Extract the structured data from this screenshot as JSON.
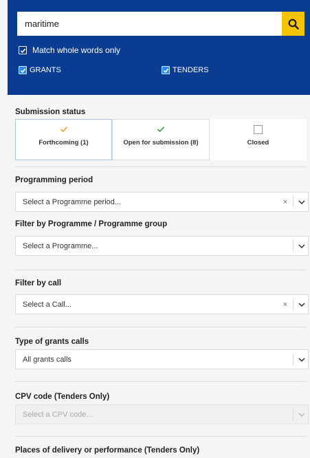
{
  "search": {
    "value": "maritime",
    "placeholder": ""
  },
  "options": {
    "match_whole_words": "Match whole words only",
    "grants": "GRANTS",
    "tenders": "TENDERS"
  },
  "submission_status": {
    "title": "Submission status",
    "items": [
      {
        "label": "Forthcoming (1)",
        "state": "checked",
        "color": "#f0a030"
      },
      {
        "label": "Open for submission (8)",
        "state": "checked",
        "color": "#3a9a3a"
      },
      {
        "label": "Closed",
        "state": "unchecked"
      }
    ]
  },
  "programming_period": {
    "title": "Programming period",
    "placeholder": "Select a Programme period..."
  },
  "programme": {
    "title": "Filter by Programme / Programme group",
    "placeholder": "Select a Programme..."
  },
  "call": {
    "title": "Filter by call",
    "placeholder": "Select a Call..."
  },
  "grants_calls": {
    "title": "Type of grants calls",
    "value": "All grants calls"
  },
  "cpv": {
    "title": "CPV code (Tenders Only)",
    "placeholder": "Select a CPV code..."
  },
  "places": {
    "title": "Places of delivery or performance (Tenders Only)"
  },
  "icons": {
    "clear": "×"
  },
  "colors": {
    "header_blue": "#0a3d91",
    "search_yellow": "#f5c400",
    "checkbox_blue": "#2d8cf0"
  }
}
